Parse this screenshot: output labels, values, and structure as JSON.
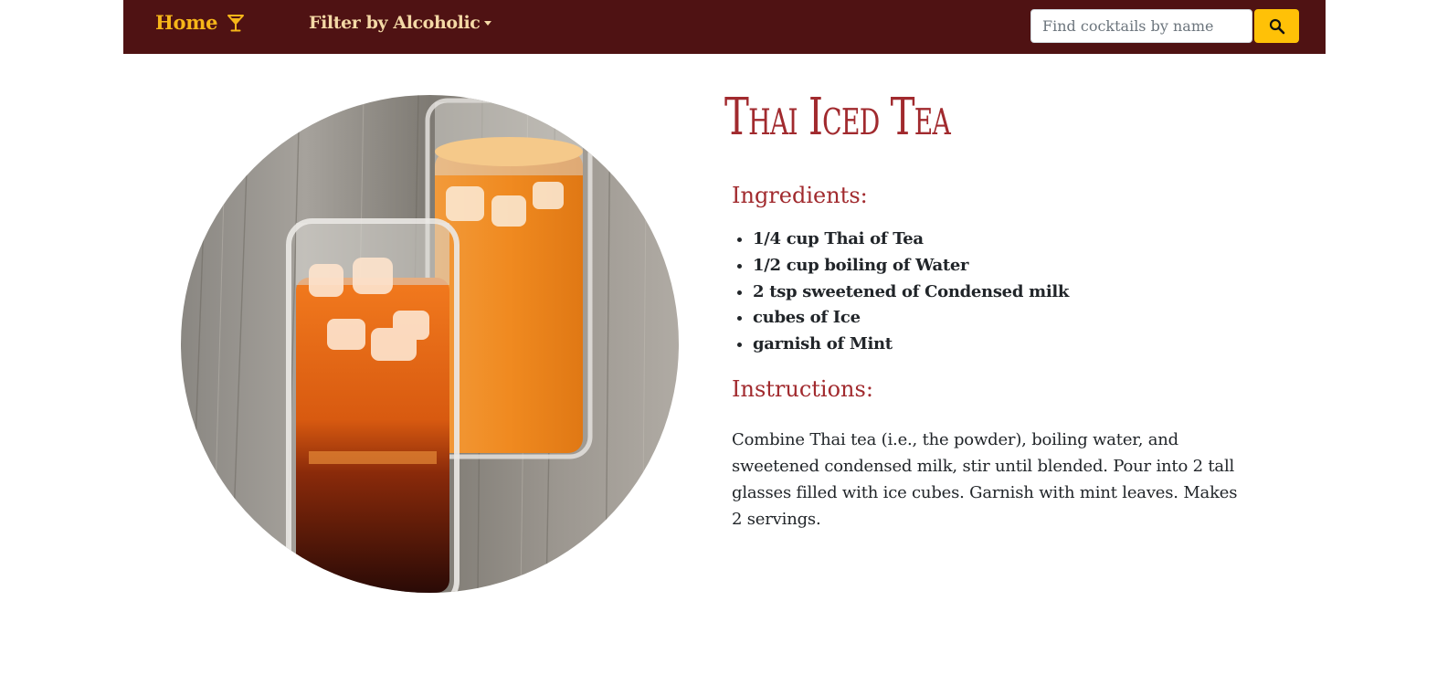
{
  "navbar": {
    "home_label": "Home",
    "home_icon": "cocktail-glass-icon",
    "filter_label": "Filter by Alcoholic",
    "filter_icon": "caret-down-icon",
    "search_placeholder": "Find cocktails by name",
    "search_value": "",
    "search_icon": "search-icon"
  },
  "drink": {
    "name": "Thai Iced Tea",
    "ingredients_heading": "Ingredients:",
    "ingredients": [
      "1/4 cup Thai of Tea",
      "1/2 cup boiling of Water",
      "2 tsp sweetened of Condensed milk",
      "cubes of Ice",
      "garnish of Mint"
    ],
    "instructions_heading": "Instructions:",
    "instructions": "Combine Thai tea (i.e., the powder), boiling water, and sweetened condensed milk, stir until blended. Pour into 2 tall glasses filled with ice cubes. Garnish with mint leaves. Makes 2 servings."
  },
  "colors": {
    "navbar_bg": "#4f1213",
    "brand_accent": "#f6b619",
    "search_button": "#ffc107",
    "heading_red": "#a12a2e"
  }
}
